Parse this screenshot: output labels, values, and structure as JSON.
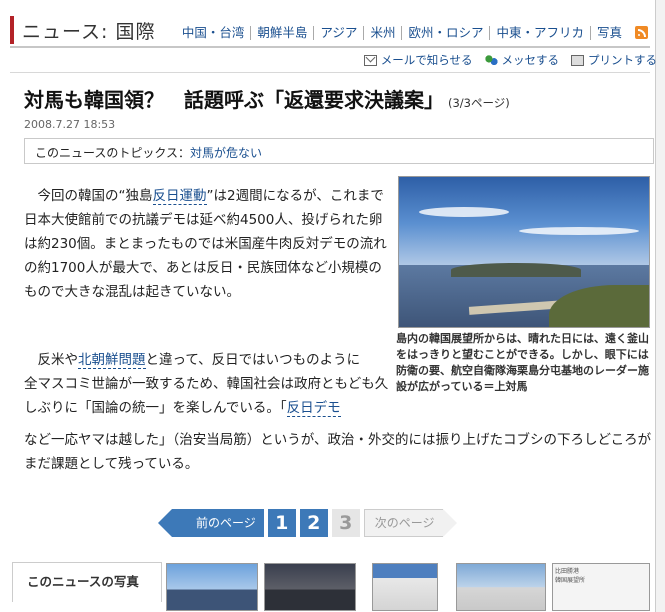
{
  "header": {
    "section_title": "ニュース: 国際",
    "nav": [
      "中国・台湾",
      "朝鮮半島",
      "アジア",
      "米州",
      "欧州・ロシア",
      "中東・アフリカ",
      "写真"
    ]
  },
  "tools": {
    "mail": "メールで知らせる",
    "messenger": "メッセする",
    "print": "プリントする"
  },
  "article": {
    "headline": "対馬も韓国領？　話題呼ぶ「返還要求決議案」",
    "page_indicator": "(3/3ページ)",
    "datetime": "2008.7.27 18:53",
    "topics_label": "このニュースのトピックス：",
    "topics_link": "対馬が危ない",
    "p1_a": "今回の韓国の“独島",
    "p1_kw": "反日運動",
    "p1_b": "”は2週間になるが、これまで日本大使館前での抗議デモは延べ約4500人、投げられた卵は約230個。まとまったものでは米国産牛肉反対デモの流れの約1700人が最大で、あとは反日・民族団体など小規模のもので大きな混乱は起きていない。",
    "p2_a": "反米や",
    "p2_kw1": "北朝鮮問題",
    "p2_b": "と違って、反日ではいつものように全マスコミ世論が一致するため、韓国社会は政府ともども久しぶりに「国論の統一」を楽しんでいる。「",
    "p2_kw2": "反日デモ",
    "p2_c": "など一応ヤマは越した」（治安当局筋）というが、政治・外交的には振り上げたコブシの下ろしどころがまだ課題として残っている。",
    "photo_caption": "島内の韓国展望所からは、晴れた日には、遠く釜山をはっきりと望むことができる。しかし、眼下には防衛の要、航空自衛隊海栗島分屯基地のレーダー施設が広がっている＝上対馬"
  },
  "pager": {
    "prev": "前のページ",
    "pages": [
      "1",
      "2",
      "3"
    ],
    "next": "次のページ"
  },
  "photos": {
    "label": "このニュースの写真",
    "thumb5_lines": [
      "比田勝港",
      "韓国展望所"
    ]
  },
  "colors": {
    "accent_red": "#b32227",
    "link_blue": "#1a4f8f",
    "pager_blue": "#3d79b8"
  }
}
